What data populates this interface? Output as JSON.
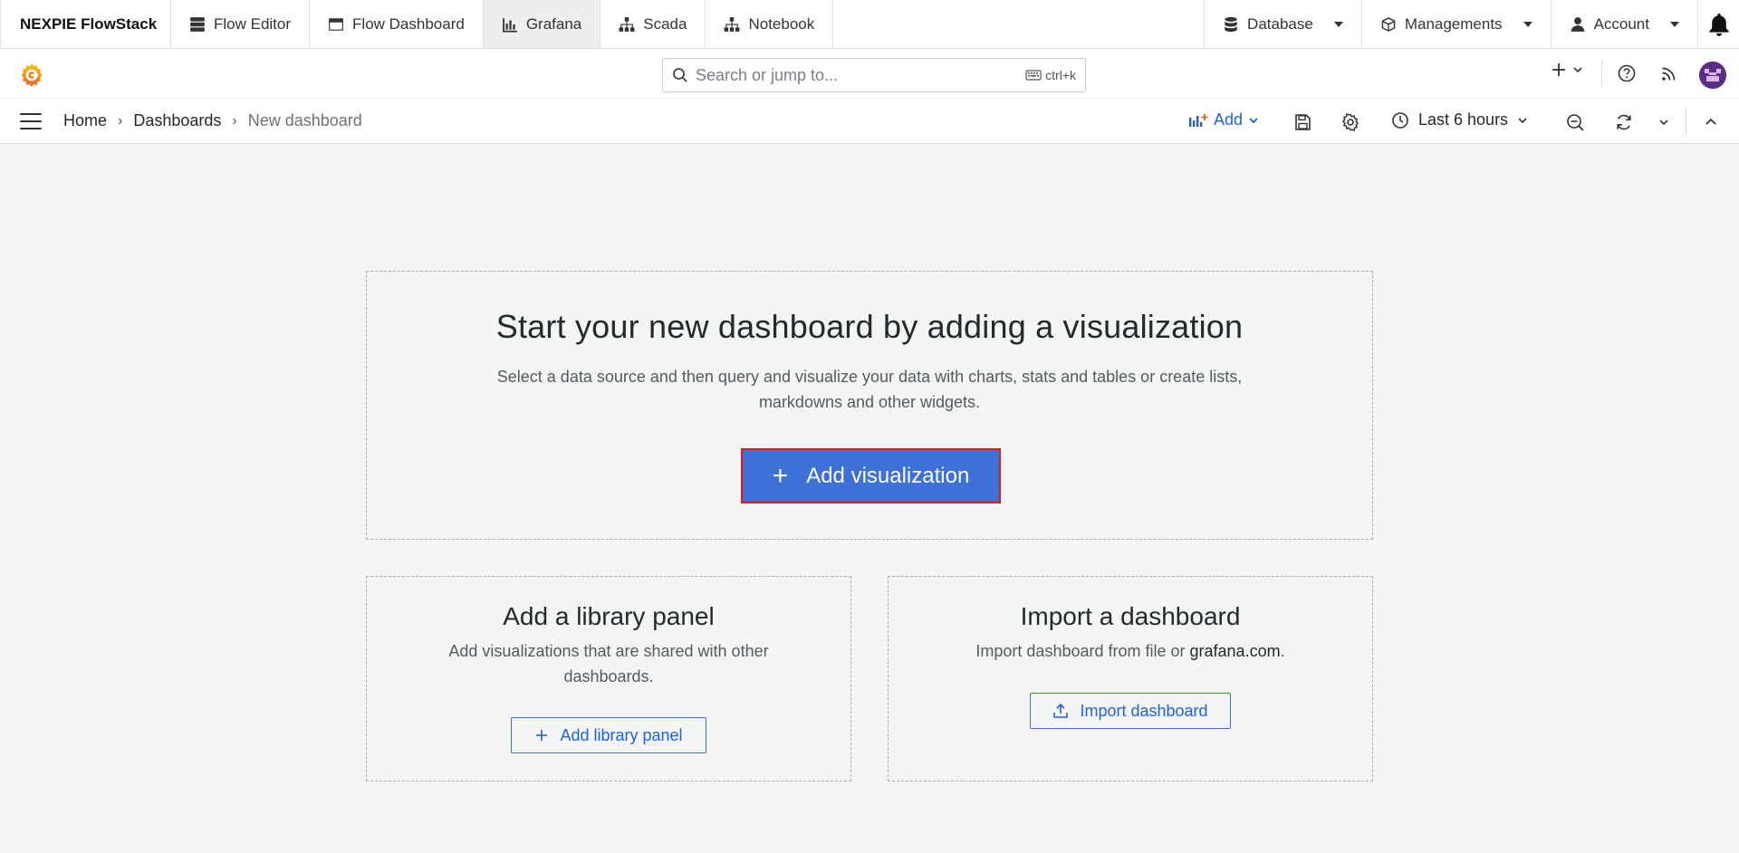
{
  "topnav": {
    "brand": "NEXPIE FlowStack",
    "tabs": [
      {
        "label": "Flow Editor",
        "icon": "server-icon"
      },
      {
        "label": "Flow Dashboard",
        "icon": "window-icon"
      },
      {
        "label": "Grafana",
        "icon": "bar-chart-icon",
        "active": true
      },
      {
        "label": "Scada",
        "icon": "sitemap-icon"
      },
      {
        "label": "Notebook",
        "icon": "sitemap-icon"
      }
    ],
    "right": [
      {
        "label": "Database",
        "icon": "database-icon"
      },
      {
        "label": "Managements",
        "icon": "cube-icon"
      },
      {
        "label": "Account",
        "icon": "user-icon"
      }
    ]
  },
  "grafana_header": {
    "search_placeholder": "Search or jump to...",
    "shortcut": "ctrl+k"
  },
  "toolbar": {
    "breadcrumb": [
      "Home",
      "Dashboards",
      "New dashboard"
    ],
    "add_label": "Add",
    "time_range": "Last 6 hours"
  },
  "main": {
    "title": "Start your new dashboard by adding a visualization",
    "description": "Select a data source and then query and visualize your data with charts, stats and tables or create lists, markdowns and other widgets.",
    "add_visualization_label": "Add visualization"
  },
  "library": {
    "title": "Add a library panel",
    "description": "Add visualizations that are shared with other dashboards.",
    "button_label": "Add library panel"
  },
  "import": {
    "title": "Import a dashboard",
    "description_prefix": "Import dashboard from file or ",
    "link_text": "grafana.com",
    "description_suffix": ".",
    "button_label": "Import dashboard"
  },
  "colors": {
    "primary": "#3d71d9",
    "link": "#1f62e0",
    "highlight_border": "#d51f1f",
    "background": "#f4f5f5"
  }
}
